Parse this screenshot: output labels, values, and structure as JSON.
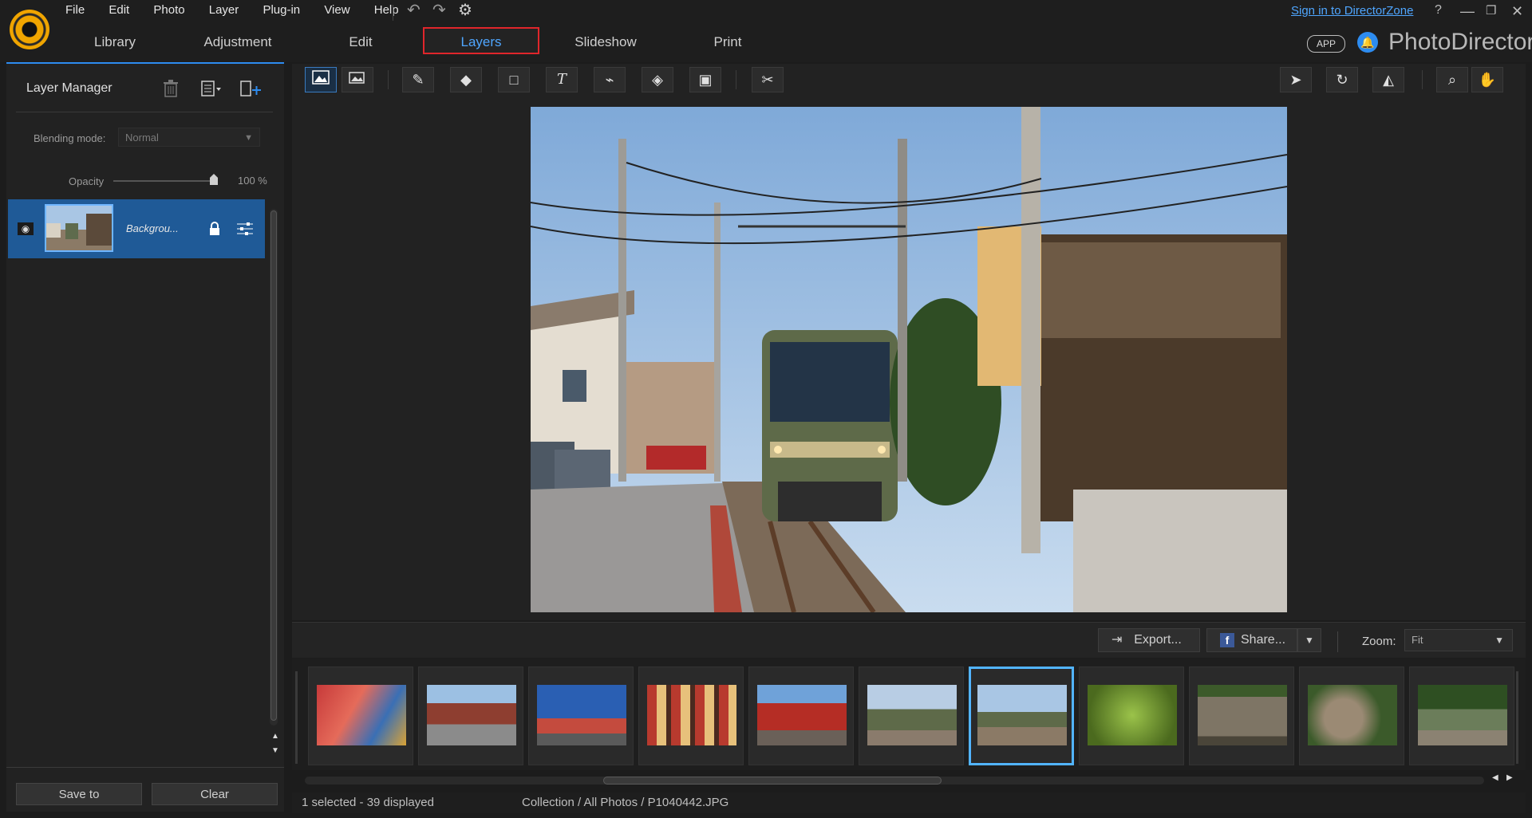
{
  "menu": [
    "File",
    "Edit",
    "Photo",
    "Layer",
    "Plug-in",
    "View",
    "Help"
  ],
  "tabs": [
    {
      "label": "Library"
    },
    {
      "label": "Adjustment"
    },
    {
      "label": "Edit"
    },
    {
      "label": "Layers"
    },
    {
      "label": "Slideshow"
    },
    {
      "label": "Print"
    }
  ],
  "active_tab": "Layers",
  "header": {
    "signin": "Sign in to DirectorZone",
    "help": "?",
    "app_badge": "APP",
    "brand": "PhotoDirector"
  },
  "layer_manager": {
    "title": "Layer Manager",
    "blending_label": "Blending mode:",
    "blending_value": "Normal",
    "opacity_label": "Opacity",
    "opacity_value": "100 %",
    "opacity_level": 1.0,
    "layers": [
      {
        "name": "Backgrou..."
      }
    ],
    "save_button": "Save to",
    "clear_button": "Clear"
  },
  "bottom": {
    "export": "Export...",
    "share": "Share...",
    "zoom_label": "Zoom:",
    "zoom_value": "Fit"
  },
  "status": {
    "selection": "1 selected - 39 displayed",
    "path": "Collection / All Photos / P1040442.JPG"
  },
  "icons": {
    "eye": "eye-icon",
    "lock": "lock-icon",
    "settings": "sliders-icon",
    "trash": "trash-icon"
  },
  "colors": {
    "accent": "#2d8cf0",
    "active_tab_text": "#4fa6ff",
    "highlight_border": "#e0262b",
    "selected_row": "#1f5a97"
  }
}
